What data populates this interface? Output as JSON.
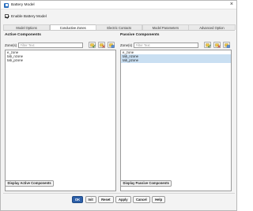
{
  "window": {
    "title": "Battery Model",
    "close_glyph": "×",
    "icon": "app-icon"
  },
  "enable_model": {
    "label": "Enable Battery Model",
    "checked": true
  },
  "tabs": [
    {
      "label": "Model Options",
      "active": false
    },
    {
      "label": "Conductive Zones",
      "active": true
    },
    {
      "label": "Electric Contacts",
      "active": false
    },
    {
      "label": "Model Parameters",
      "active": false
    },
    {
      "label": "Advanced Option",
      "active": false
    }
  ],
  "active_panel": {
    "title": "Active Components",
    "zone_label": "Zone(s)",
    "filter_placeholder": "Filter Text",
    "items": [
      {
        "label": "e_zone",
        "selected": false
      },
      {
        "label": "tab_nzone",
        "selected": false
      },
      {
        "label": "tab_pzone",
        "selected": false
      }
    ],
    "display_button": "Display Active Components"
  },
  "passive_panel": {
    "title": "Passive Components",
    "zone_label": "Zone(s)",
    "filter_placeholder": "Filter Text",
    "items": [
      {
        "label": "e_zone",
        "selected": false
      },
      {
        "label": "tab_nzone",
        "selected": true
      },
      {
        "label": "tab_pzone",
        "selected": true
      }
    ],
    "display_button": "Display Passive Components"
  },
  "buttons": {
    "ok": "OK",
    "init": "Init",
    "reset": "Reset",
    "apply": "Apply",
    "cancel": "Cancel",
    "help": "Help"
  },
  "colors": {
    "accent": "#2c5fa8",
    "selection": "#c9dff2"
  }
}
